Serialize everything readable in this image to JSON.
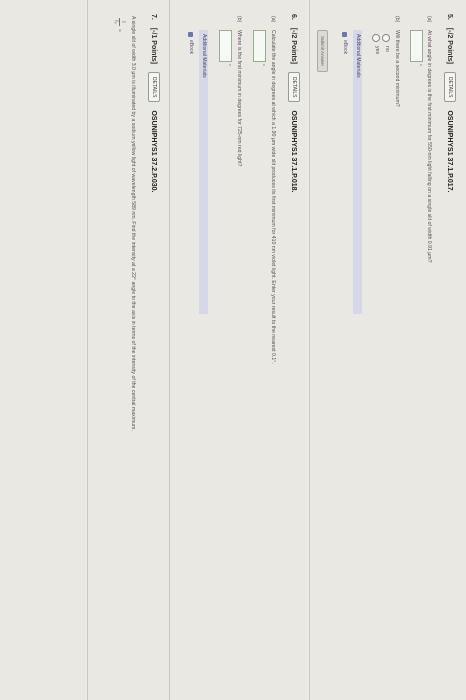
{
  "q5": {
    "number": "5.",
    "points": "[-/2 Points]",
    "details": "DETAILS",
    "code": "OSUNIPHYS1 37.1.P.017.",
    "a_label": "(a)",
    "a_text": "At what angle in degrees is the first minimum for 550-nm light falling on a single slit of width 0.91 μm?",
    "a_unit": "°",
    "b_label": "(b)",
    "b_text": "Will there be a second minimum?",
    "opt_no": "no",
    "opt_yes": "yes",
    "additional": "Additional Materials",
    "ebook": "eBook",
    "submit": "Submit Answer"
  },
  "q6": {
    "number": "6.",
    "points": "[-/2 Points]",
    "details": "DETAILS",
    "code": "OSUNIPHYS1 37.1.P.018.",
    "a_label": "(a)",
    "a_text": "Calculate the angle in degrees at which a 1.90 μm wide slit produces its first minimum for 410 nm violet light. Enter your result to the nearest 0.1°.",
    "a_unit": "°",
    "b_label": "(b)",
    "b_text": "Where is the first minimum in degrees for 725-nm red light?",
    "b_unit": "°",
    "additional": "Additional Materials",
    "ebook": "eBook"
  },
  "q7": {
    "number": "7.",
    "points": "[-/1 Points]",
    "details": "DETAILS",
    "code": "OSUNIPHYS1 37.2.P.030.",
    "text": "A single slit of width 3.0 μm is illuminated by a sodium yellow light of wavelength 589 nm. Find the intensity at a 22° angle to the axis in terms of the intensity of the central maximum.",
    "frac_num": "I",
    "frac_den": "I₀",
    "frac_eq": "="
  }
}
